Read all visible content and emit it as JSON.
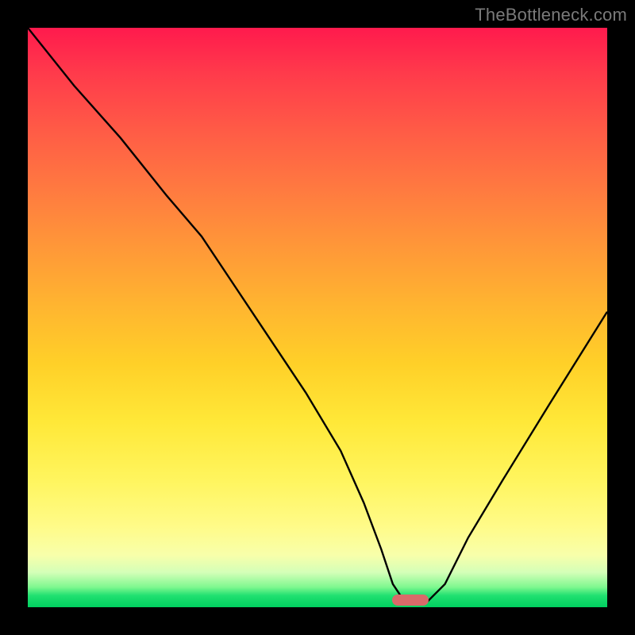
{
  "watermark": "TheBottleneck.com",
  "colors": {
    "background": "#000000",
    "curve_stroke": "#000000",
    "marker": "#d96a6a",
    "gradient_top": "#ff1a4d",
    "gradient_bottom": "#00d060"
  },
  "chart_data": {
    "type": "line",
    "title": "",
    "xlabel": "",
    "ylabel": "",
    "xlim": [
      0,
      100
    ],
    "ylim": [
      0,
      100
    ],
    "grid": false,
    "legend": false,
    "annotations": [
      {
        "type": "marker-pill",
        "x": 66,
        "y": 1.2,
        "color": "#d96a6a"
      }
    ],
    "series": [
      {
        "name": "bottleneck-curve",
        "x": [
          0,
          8,
          16,
          24,
          30,
          36,
          42,
          48,
          54,
          58,
          61,
          63,
          65,
          67,
          69,
          72,
          76,
          82,
          90,
          100
        ],
        "y": [
          100,
          90,
          81,
          71,
          64,
          55,
          46,
          37,
          27,
          18,
          10,
          4,
          1,
          1,
          1,
          4,
          12,
          22,
          35,
          51
        ]
      }
    ],
    "background_gradient": {
      "direction": "vertical",
      "stops": [
        {
          "pos": 0.0,
          "color": "#ff1a4d"
        },
        {
          "pos": 0.3,
          "color": "#ff7a40"
        },
        {
          "pos": 0.6,
          "color": "#ffd028"
        },
        {
          "pos": 0.85,
          "color": "#fffb88"
        },
        {
          "pos": 1.0,
          "color": "#00d060"
        }
      ]
    }
  }
}
